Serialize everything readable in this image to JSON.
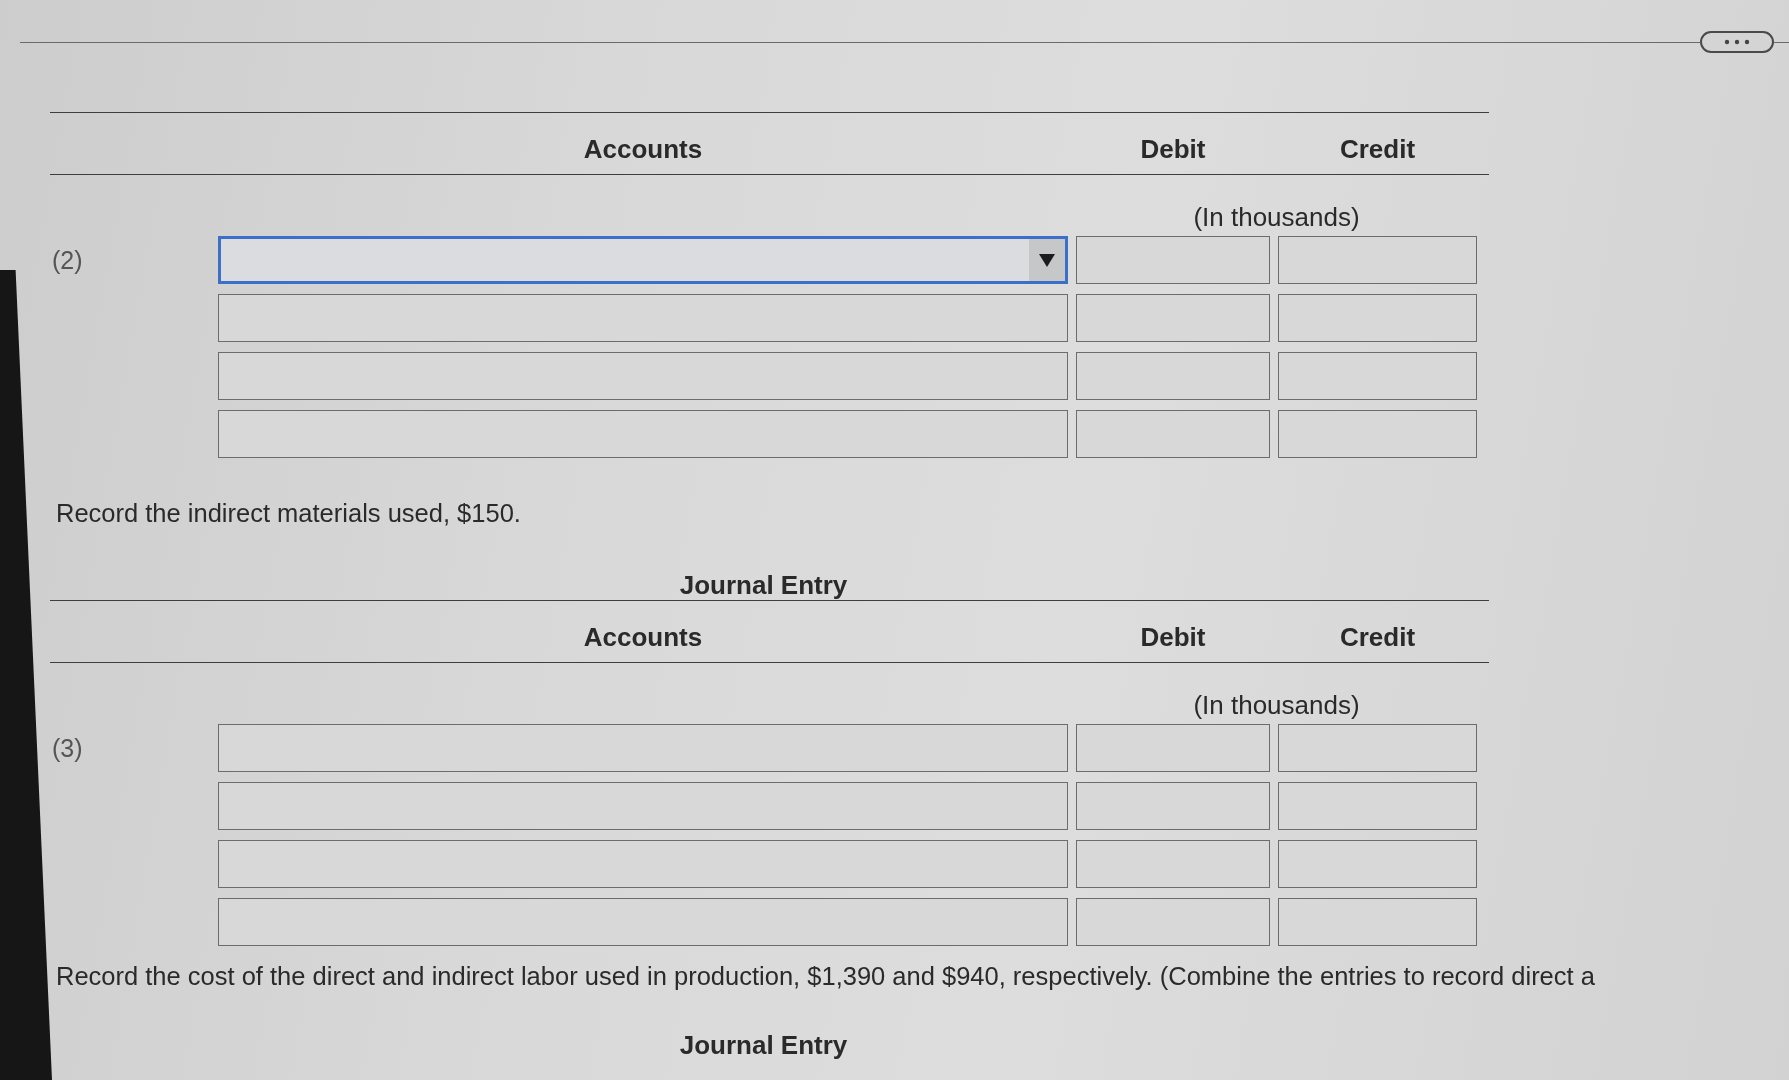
{
  "entries": [
    {
      "number": "(2)",
      "columns": [
        "Accounts",
        "Debit",
        "Credit"
      ],
      "unit_note": "(In thousands)",
      "rows": [
        {
          "kind": "dropdown",
          "focused": true
        },
        {
          "kind": "field",
          "focused": false
        },
        {
          "kind": "field",
          "focused": false
        },
        {
          "kind": "field",
          "focused": false
        }
      ]
    },
    {
      "instruction": "Record the indirect materials used, $150.",
      "title": "Journal Entry",
      "number": "(3)",
      "columns": [
        "Accounts",
        "Debit",
        "Credit"
      ],
      "unit_note": "(In thousands)",
      "rows": [
        {
          "kind": "field",
          "focused": false
        },
        {
          "kind": "field",
          "focused": false
        },
        {
          "kind": "field",
          "focused": false
        },
        {
          "kind": "field",
          "focused": false
        }
      ]
    },
    {
      "instruction": "Record the cost of the direct and indirect labor used in production, $1,390 and $940, respectively. (Combine the entries to record direct a",
      "title": "Journal Entry"
    }
  ]
}
